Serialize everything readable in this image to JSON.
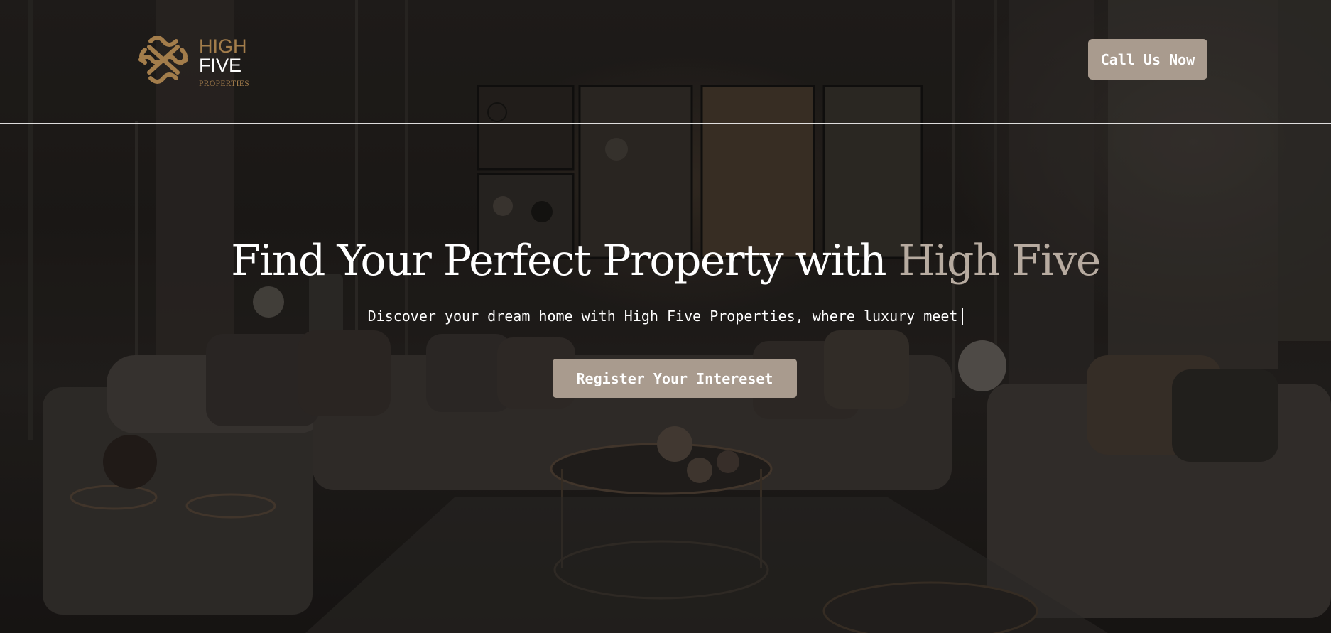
{
  "header": {
    "logo": {
      "line1": "HIGH",
      "line2": "FIVE",
      "line3": "PROPERTIES"
    },
    "call_button_label": "Call Us Now"
  },
  "hero": {
    "headline_main": "Find Your Perfect Property with",
    "headline_accent": "High Five",
    "subtitle": "Discover your dream home with High Five Properties, where luxury meet",
    "register_button_label": "Register Your Intereset"
  },
  "icons": {
    "logo_mark": "interlaced-knot-logo-icon",
    "text_caret": "text-cursor-icon"
  },
  "colors": {
    "brand_gold": "#a37d4b",
    "button_bg": "#a99b8e",
    "headline_accent": "#b7aba0",
    "text": "#ffffff"
  }
}
